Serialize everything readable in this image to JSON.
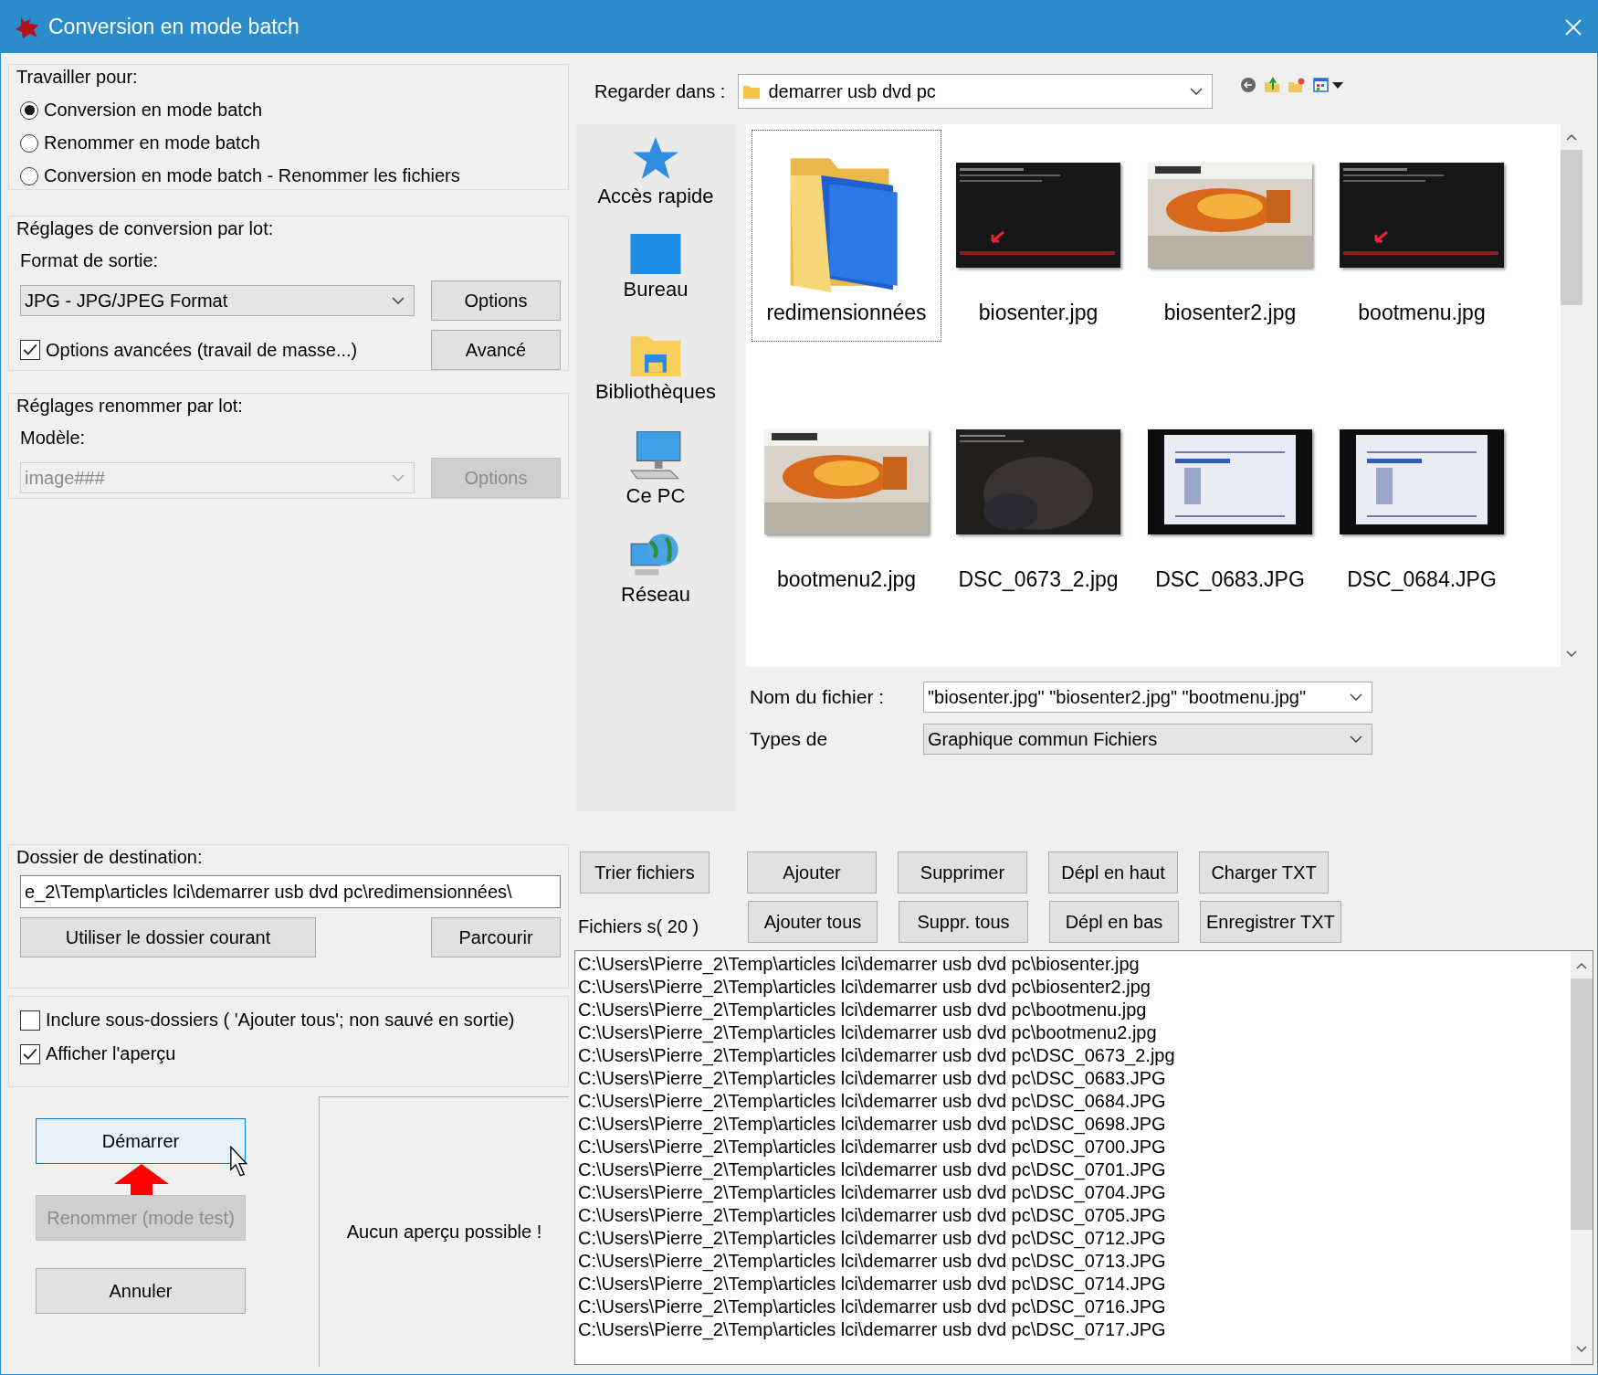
{
  "window": {
    "title": "Conversion en mode batch"
  },
  "work_for": {
    "legend": "Travailler pour:",
    "options": [
      {
        "label": "Conversion en mode batch",
        "selected": true
      },
      {
        "label": "Renommer en mode batch",
        "selected": false
      },
      {
        "label": "Conversion en mode batch - Renommer les fichiers",
        "selected": false
      }
    ]
  },
  "conversion": {
    "legend": "Réglages de conversion par lot:",
    "format_label": "Format de sortie:",
    "format_value": "JPG - JPG/JPEG Format",
    "options_button": "Options",
    "advanced": {
      "label": "Options avancées (travail de masse...)",
      "checked": true
    },
    "advanced_button": "Avancé"
  },
  "rename": {
    "legend": "Réglages renommer par lot:",
    "model_label": "Modèle:",
    "model_value": "image###",
    "disabled": true,
    "options_button": "Options"
  },
  "destination": {
    "legend": "Dossier de destination:",
    "value": "e_2\\Temp\\articles lci\\demarrer usb dvd pc\\redimensionnées\\",
    "use_current_button": "Utiliser le dossier courant",
    "browse_button": "Parcourir"
  },
  "include_subfolders": {
    "label": "Inclure sous-dossiers ( 'Ajouter tous'; non sauvé en sortie)",
    "checked": false
  },
  "show_preview": {
    "label": "Afficher l'aperçu",
    "checked": true
  },
  "actions": [
    {
      "label": "Démarrer",
      "hovered": true,
      "disabled": false
    },
    {
      "label": "Renommer (mode test)",
      "hovered": false,
      "disabled": true
    },
    {
      "label": "Annuler",
      "hovered": false,
      "disabled": false
    }
  ],
  "preview": {
    "message": "Aucun aperçu possible !"
  },
  "browser": {
    "look_in_label": "Regarder dans :",
    "look_in_value": "demarrer usb dvd pc",
    "places": [
      {
        "label": "Accès rapide",
        "kind": "star"
      },
      {
        "label": "Bureau",
        "kind": "desktop"
      },
      {
        "label": "Bibliothèques",
        "kind": "library"
      },
      {
        "label": "Ce PC",
        "kind": "computer"
      },
      {
        "label": "Réseau",
        "kind": "network"
      }
    ],
    "items": [
      {
        "name": "redimensionnées",
        "kind": "folder",
        "focused": true
      },
      {
        "name": "biosenter.jpg",
        "kind": "picture",
        "focused": false
      },
      {
        "name": "biosenter2.jpg",
        "kind": "picture",
        "focused": false
      },
      {
        "name": "bootmenu.jpg",
        "kind": "picture",
        "focused": false
      },
      {
        "name": "bootmenu2.jpg",
        "kind": "picture",
        "focused": false
      },
      {
        "name": "DSC_0673_2.jpg",
        "kind": "picture",
        "focused": false
      },
      {
        "name": "DSC_0683.JPG",
        "kind": "picture",
        "focused": false
      },
      {
        "name": "DSC_0684.JPG",
        "kind": "picture",
        "focused": false
      }
    ],
    "filename_label": "Nom du fichier :",
    "filename_value": "\"biosenter.jpg\" \"biosenter2.jpg\" \"bootmenu.jpg\"",
    "types_label": "Types de",
    "types_value": "Graphique commun Fichiers"
  },
  "list_buttons_top": [
    "Trier fichiers",
    "Ajouter",
    "Supprimer",
    "Dépl en haut",
    "Charger TXT"
  ],
  "files_label": "Fichiers s( 20 )",
  "list_buttons_bottom": [
    "Ajouter tous",
    "Suppr. tous",
    "Dépl en bas",
    "Enregistrer TXT"
  ],
  "files": [
    "C:\\Users\\Pierre_2\\Temp\\articles lci\\demarrer usb dvd pc\\biosenter.jpg",
    "C:\\Users\\Pierre_2\\Temp\\articles lci\\demarrer usb dvd pc\\biosenter2.jpg",
    "C:\\Users\\Pierre_2\\Temp\\articles lci\\demarrer usb dvd pc\\bootmenu.jpg",
    "C:\\Users\\Pierre_2\\Temp\\articles lci\\demarrer usb dvd pc\\bootmenu2.jpg",
    "C:\\Users\\Pierre_2\\Temp\\articles lci\\demarrer usb dvd pc\\DSC_0673_2.jpg",
    "C:\\Users\\Pierre_2\\Temp\\articles lci\\demarrer usb dvd pc\\DSC_0683.JPG",
    "C:\\Users\\Pierre_2\\Temp\\articles lci\\demarrer usb dvd pc\\DSC_0684.JPG",
    "C:\\Users\\Pierre_2\\Temp\\articles lci\\demarrer usb dvd pc\\DSC_0698.JPG",
    "C:\\Users\\Pierre_2\\Temp\\articles lci\\demarrer usb dvd pc\\DSC_0700.JPG",
    "C:\\Users\\Pierre_2\\Temp\\articles lci\\demarrer usb dvd pc\\DSC_0701.JPG",
    "C:\\Users\\Pierre_2\\Temp\\articles lci\\demarrer usb dvd pc\\DSC_0704.JPG",
    "C:\\Users\\Pierre_2\\Temp\\articles lci\\demarrer usb dvd pc\\DSC_0705.JPG",
    "C:\\Users\\Pierre_2\\Temp\\articles lci\\demarrer usb dvd pc\\DSC_0712.JPG",
    "C:\\Users\\Pierre_2\\Temp\\articles lci\\demarrer usb dvd pc\\DSC_0713.JPG",
    "C:\\Users\\Pierre_2\\Temp\\articles lci\\demarrer usb dvd pc\\DSC_0714.JPG",
    "C:\\Users\\Pierre_2\\Temp\\articles lci\\demarrer usb dvd pc\\DSC_0716.JPG",
    "C:\\Users\\Pierre_2\\Temp\\articles lci\\demarrer usb dvd pc\\DSC_0717.JPG"
  ]
}
